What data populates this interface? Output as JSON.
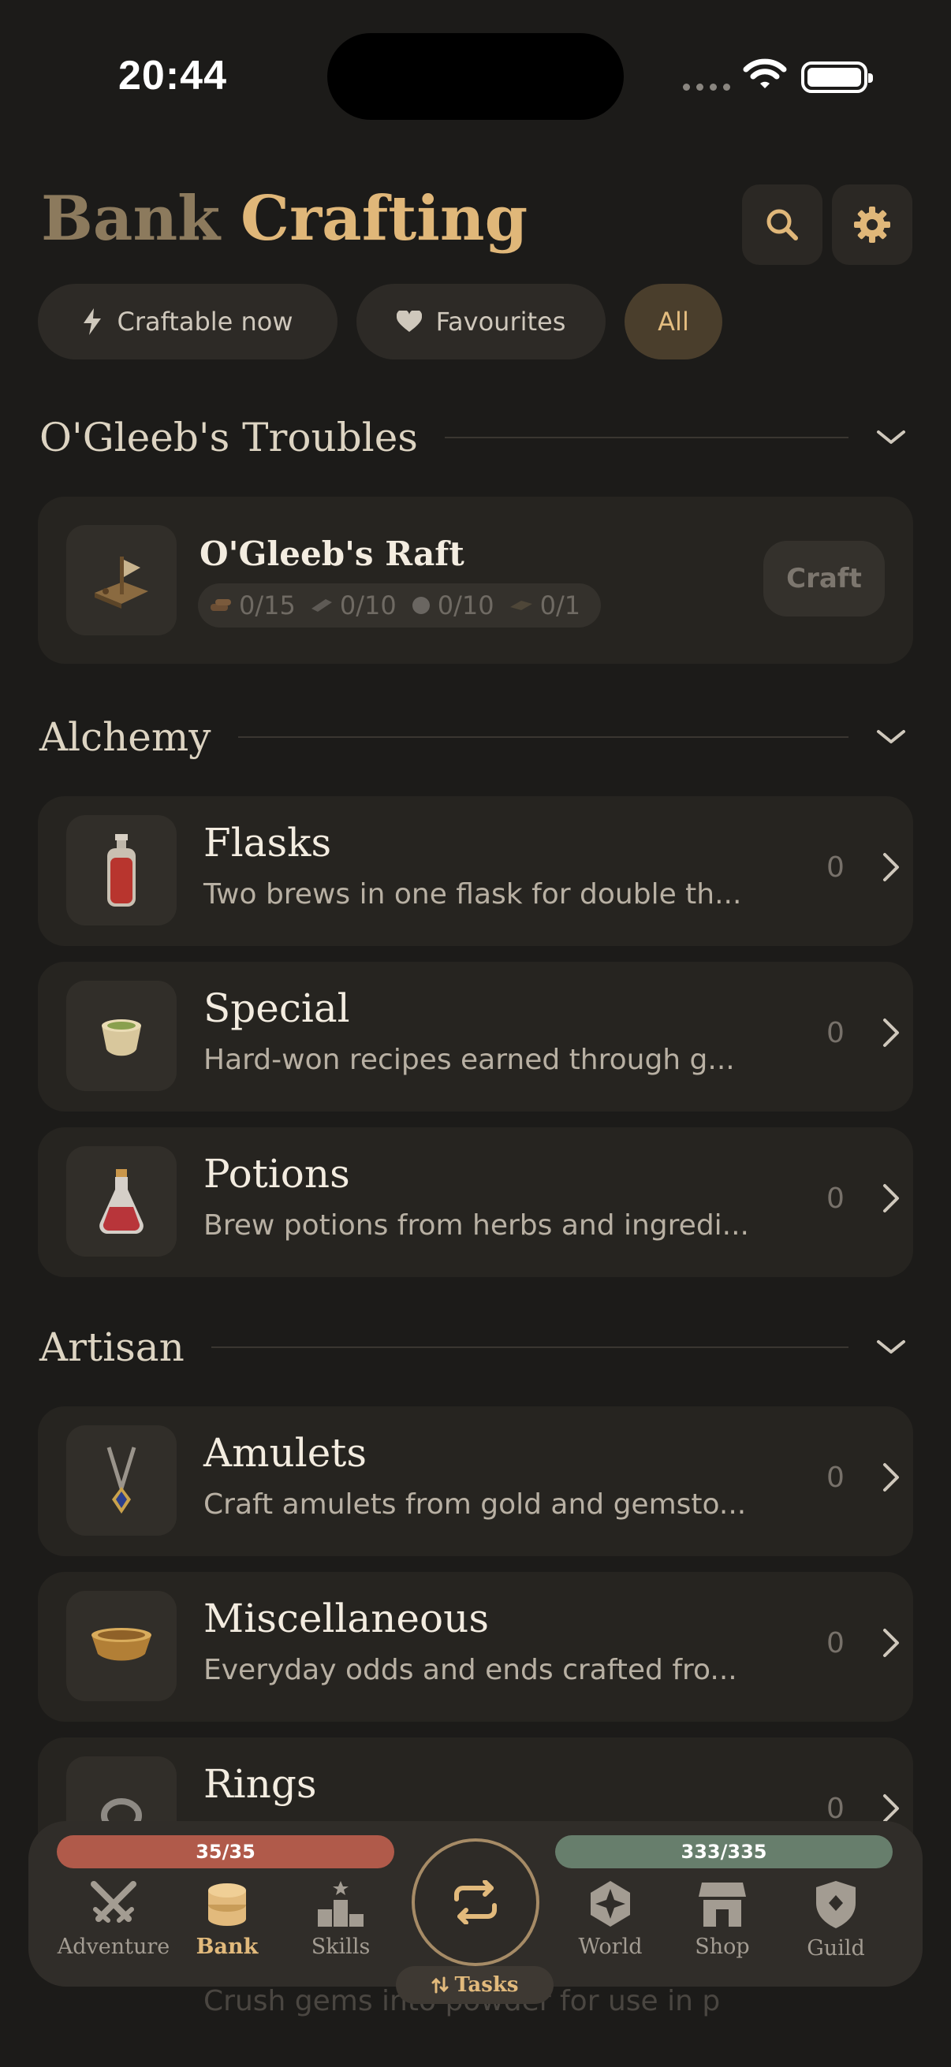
{
  "status_bar": {
    "time": "20:44"
  },
  "header": {
    "tab_bank": "Bank",
    "tab_crafting": "Crafting"
  },
  "filters": [
    {
      "label": "Craftable now",
      "icon": "bolt-icon"
    },
    {
      "label": "Favourites",
      "icon": "heart-icon"
    },
    {
      "label": "All",
      "selected": true
    }
  ],
  "sections": {
    "troubles": {
      "title": "O'Gleeb's Troubles",
      "item": {
        "title": "O'Gleeb's Raft",
        "requirements": [
          "0/15",
          "0/10",
          "0/10",
          "0/1"
        ],
        "craft_label": "Craft"
      }
    },
    "alchemy": {
      "title": "Alchemy",
      "items": [
        {
          "title": "Flasks",
          "desc": "Two brews in one flask for double th...",
          "count": "0"
        },
        {
          "title": "Special",
          "desc": "Hard-won recipes earned through g...",
          "count": "0"
        },
        {
          "title": "Potions",
          "desc": "Brew potions from herbs and ingredi...",
          "count": "0"
        }
      ]
    },
    "artisan": {
      "title": "Artisan",
      "items": [
        {
          "title": "Amulets",
          "desc": "Craft amulets from gold and gemsto...",
          "count": "0"
        },
        {
          "title": "Miscellaneous",
          "desc": "Everyday odds and ends crafted fro...",
          "count": "0"
        },
        {
          "title": "Rings",
          "desc": "",
          "count": "0"
        }
      ],
      "partial_next_desc": "Crush gems into powder for use in p"
    }
  },
  "nav": {
    "hp": "35/35",
    "xp": "333/335",
    "hp_fraction": 1.0,
    "xp_fraction": 0.994,
    "items": [
      "Adventure",
      "Bank",
      "Skills",
      "World",
      "Shop",
      "Guild"
    ],
    "active": "Bank",
    "tasks_label": "Tasks"
  },
  "colors": {
    "accent": "#e0b779",
    "background": "#1c1b19",
    "card": "#262420",
    "hp": "#b05a4a",
    "xp": "#677e6c"
  }
}
